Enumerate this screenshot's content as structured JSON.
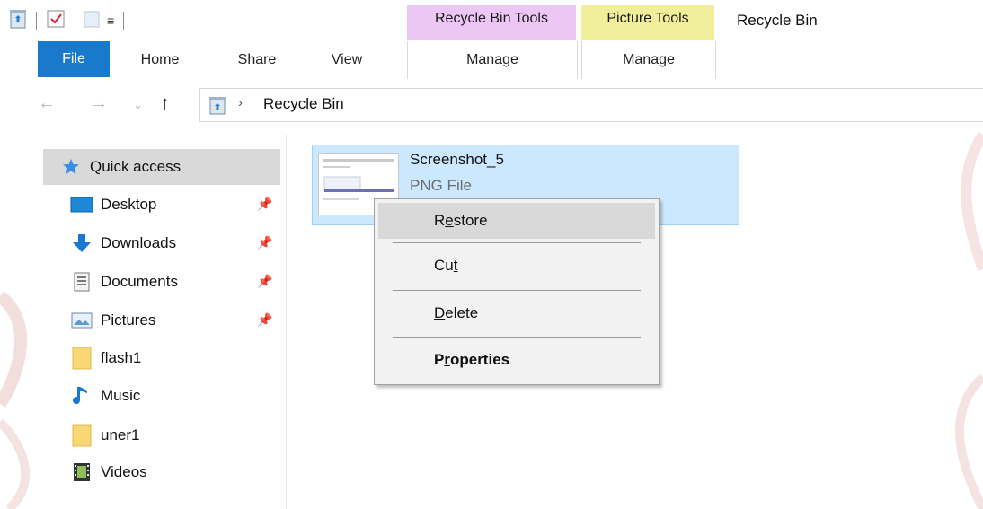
{
  "window": {
    "title": "Recycle Bin"
  },
  "context_tabs": {
    "recycle_bin_tools": "Recycle Bin Tools",
    "picture_tools": "Picture Tools"
  },
  "ribbon": {
    "tabs": [
      "File",
      "Home",
      "Share",
      "View",
      "Manage",
      "Manage"
    ]
  },
  "address": {
    "path": "Recycle Bin"
  },
  "nav_pane": {
    "items": [
      {
        "label": "Quick access",
        "icon": "star-icon",
        "pinned": false
      },
      {
        "label": "Desktop",
        "icon": "desktop-icon",
        "pinned": true
      },
      {
        "label": "Downloads",
        "icon": "download-arrow-icon",
        "pinned": true
      },
      {
        "label": "Documents",
        "icon": "document-icon",
        "pinned": true
      },
      {
        "label": "Pictures",
        "icon": "pictures-icon",
        "pinned": true
      },
      {
        "label": "flash1",
        "icon": "folder-icon",
        "pinned": false
      },
      {
        "label": "Music",
        "icon": "music-note-icon",
        "pinned": false
      },
      {
        "label": "uner1",
        "icon": "folder-icon",
        "pinned": false
      },
      {
        "label": "Videos",
        "icon": "video-icon",
        "pinned": false
      }
    ]
  },
  "file": {
    "name": "Screenshot_5",
    "type": "PNG File"
  },
  "context_menu": {
    "items": [
      {
        "pre": "R",
        "accel": "e",
        "post": "store"
      },
      {
        "pre": "Cu",
        "accel": "t",
        "post": ""
      },
      {
        "pre": "",
        "accel": "D",
        "post": "elete"
      },
      {
        "pre": "P",
        "accel": "r",
        "post": "operties"
      }
    ]
  },
  "colors": {
    "file_tab": "#1979ca",
    "recycle_bin_tools_tab": "#ecc6f5",
    "picture_tools_tab": "#f1ef9b",
    "selection": "#cce8ff",
    "quick_access_highlight": "#d9d9d9"
  }
}
